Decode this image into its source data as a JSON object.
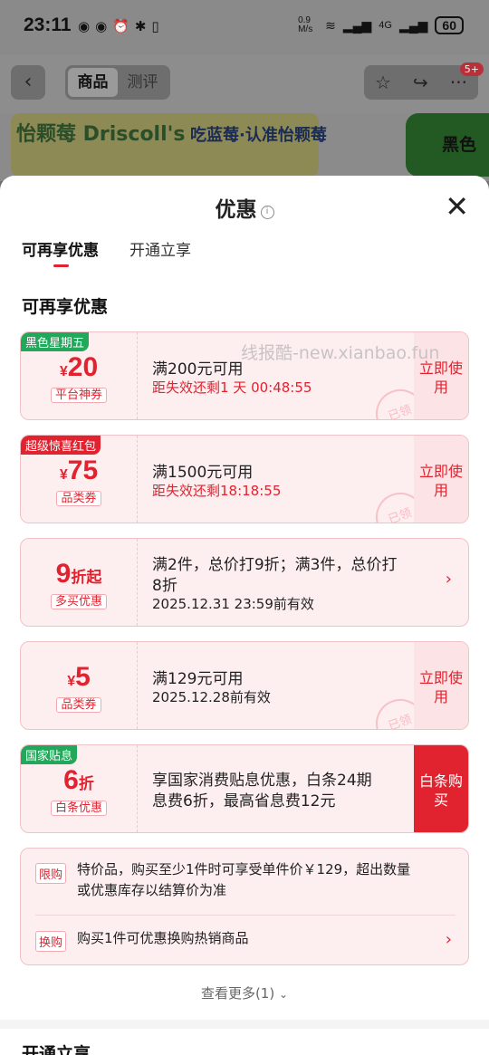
{
  "status_bar": {
    "time": "23:11",
    "speed": "0.9 M/s",
    "network": "4G",
    "battery": "60"
  },
  "product_header": {
    "tabs": [
      "商品",
      "测评"
    ],
    "badge": "5+"
  },
  "banner": {
    "brand_text": "怡颗莓 Driscoll's",
    "slogan": "吃蓝莓·认准怡颗莓",
    "right_text": "黑色"
  },
  "sheet": {
    "title": "优惠",
    "tabs": [
      "可再享优惠",
      "开通立享"
    ],
    "section_title": "可再享优惠",
    "watermark": "线报酷-new.xianbao.fun",
    "claimed_stamp": "已领"
  },
  "coupons": [
    {
      "corner_tag": "黑色星期五",
      "currency": "¥",
      "amount": "20",
      "type": "平台神券",
      "condition": "满200元可用",
      "sub": "距失效还剩1 天 00:48:55",
      "action": "立即使用"
    },
    {
      "corner_tag": "超级惊喜红包",
      "currency": "¥",
      "amount": "75",
      "type": "品类券",
      "condition": "满1500元可用",
      "sub": "距失效还剩18:18:55",
      "action": "立即使用"
    },
    {
      "amount": "9",
      "unit": "折起",
      "type": "多买优惠",
      "condition_line1": "满2件，总价打9折；满3件，总价打",
      "condition_line2": "8折",
      "sub": "2025.12.31 23:59前有效"
    },
    {
      "currency": "¥",
      "amount": "5",
      "type": "品类券",
      "condition": "满129元可用",
      "sub": "2025.12.28前有效",
      "action": "立即使用"
    },
    {
      "corner_tag": "国家贴息",
      "amount": "6",
      "unit": "折",
      "type": "白条优惠",
      "condition_line1": "享国家消费贴息优惠，白条24期",
      "condition_line2": "息费6折，最高省息费12元",
      "action": "白条购买"
    }
  ],
  "promos": [
    {
      "tag": "限购",
      "line1": "特价品，购买至少1件时可享受单件价￥129，超出数量",
      "line2": "或优惠库存以结算价为准"
    },
    {
      "tag": "换购",
      "line1": "购买1件可优惠换购热销商品"
    }
  ],
  "more_label": "查看更多(1)",
  "bottom_section_title": "开通立享",
  "colors": {
    "accent": "#e0232f",
    "card_bg": "#fdeef0",
    "tag_green": "#21a85a"
  }
}
